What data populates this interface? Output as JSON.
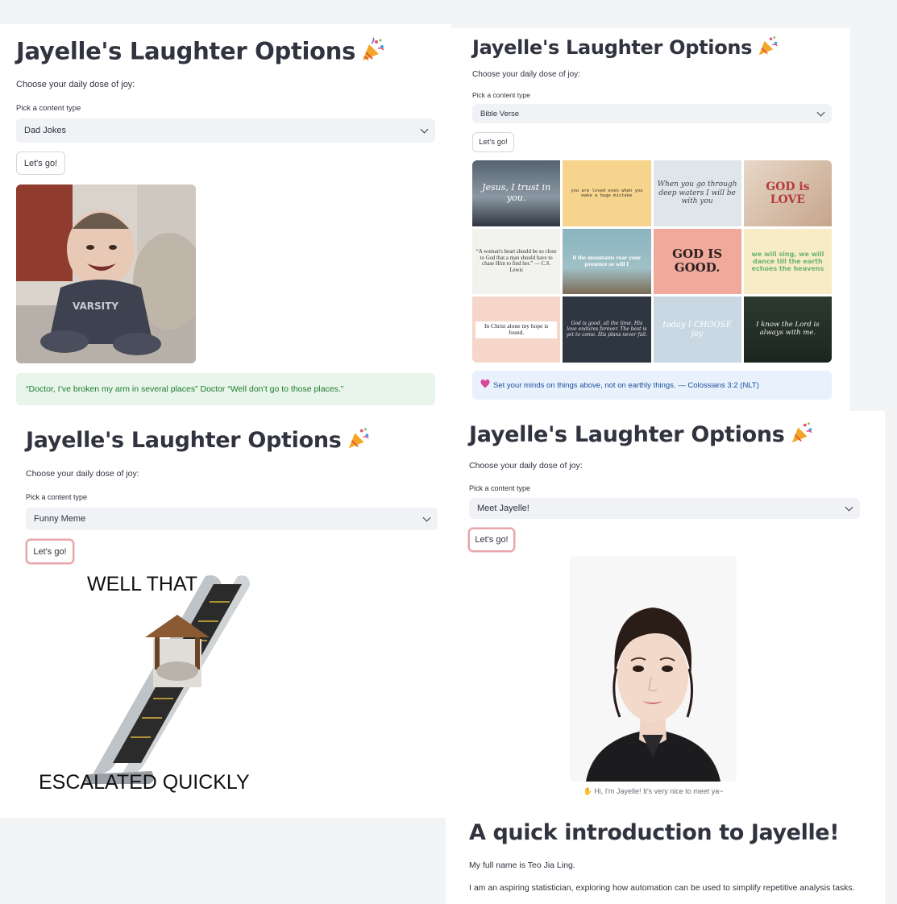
{
  "app": {
    "title": "Jayelle's Laughter Options",
    "subtitle": "Choose your daily dose of joy:",
    "select_label": "Pick a content type",
    "button_label": "Let's go!"
  },
  "panels": [
    {
      "selected": "Dad Jokes",
      "joke": "“Doctor, I’ve broken my arm in several places” Doctor “Well don’t go to those places.”"
    },
    {
      "selected": "Bible Verse",
      "verse": "Set your minds on things above, not on earthly things. — Colossians 3:2 (NLT)",
      "tiles": [
        "Jesus, I trust in you.",
        "you are loved even when you make a huge mistake",
        "When you go through deep waters I will be with you",
        "GOD is LOVE",
        "“A woman's heart should be so close to God that a man should have to chase Him to find her.” — C.S. Lewis",
        "if the mountains roar your presence so will I",
        "GOD IS GOOD.",
        "we will sing, we will dance till the earth echoes the heavens",
        "In Christ alone my hope is found.",
        "God is good, all the time. His love endures forever. The best is yet to come. His plans never fail.",
        "today I CHOOSE joy",
        "I know the Lord is always with me."
      ]
    },
    {
      "selected": "Funny Meme",
      "meme_top": "WELL THAT",
      "meme_bottom": "ESCALATED QUICKLY"
    },
    {
      "selected": "Meet Jayelle!",
      "caption": "Hi, I'm Jayelle! It's very nice to meet ya~",
      "intro_heading": "A quick introduction to Jayelle!",
      "intro_line1": "My full name is Teo Jia Ling.",
      "intro_line2": "I am an aspiring statistician, exploring how automation can be used to simplify repetitive analysis tasks."
    }
  ],
  "icons": {
    "party": "party-popper-icon",
    "heart": "heart-icon",
    "wave": "waving-hand-icon",
    "chevron": "chevron-down-icon"
  },
  "colors": {
    "accent_focus": "#e8a4a8",
    "success_bg": "#e8f5ea",
    "success_text": "#1d7b31",
    "info_bg": "#e9f1fc",
    "info_text": "#1b4f9c"
  }
}
